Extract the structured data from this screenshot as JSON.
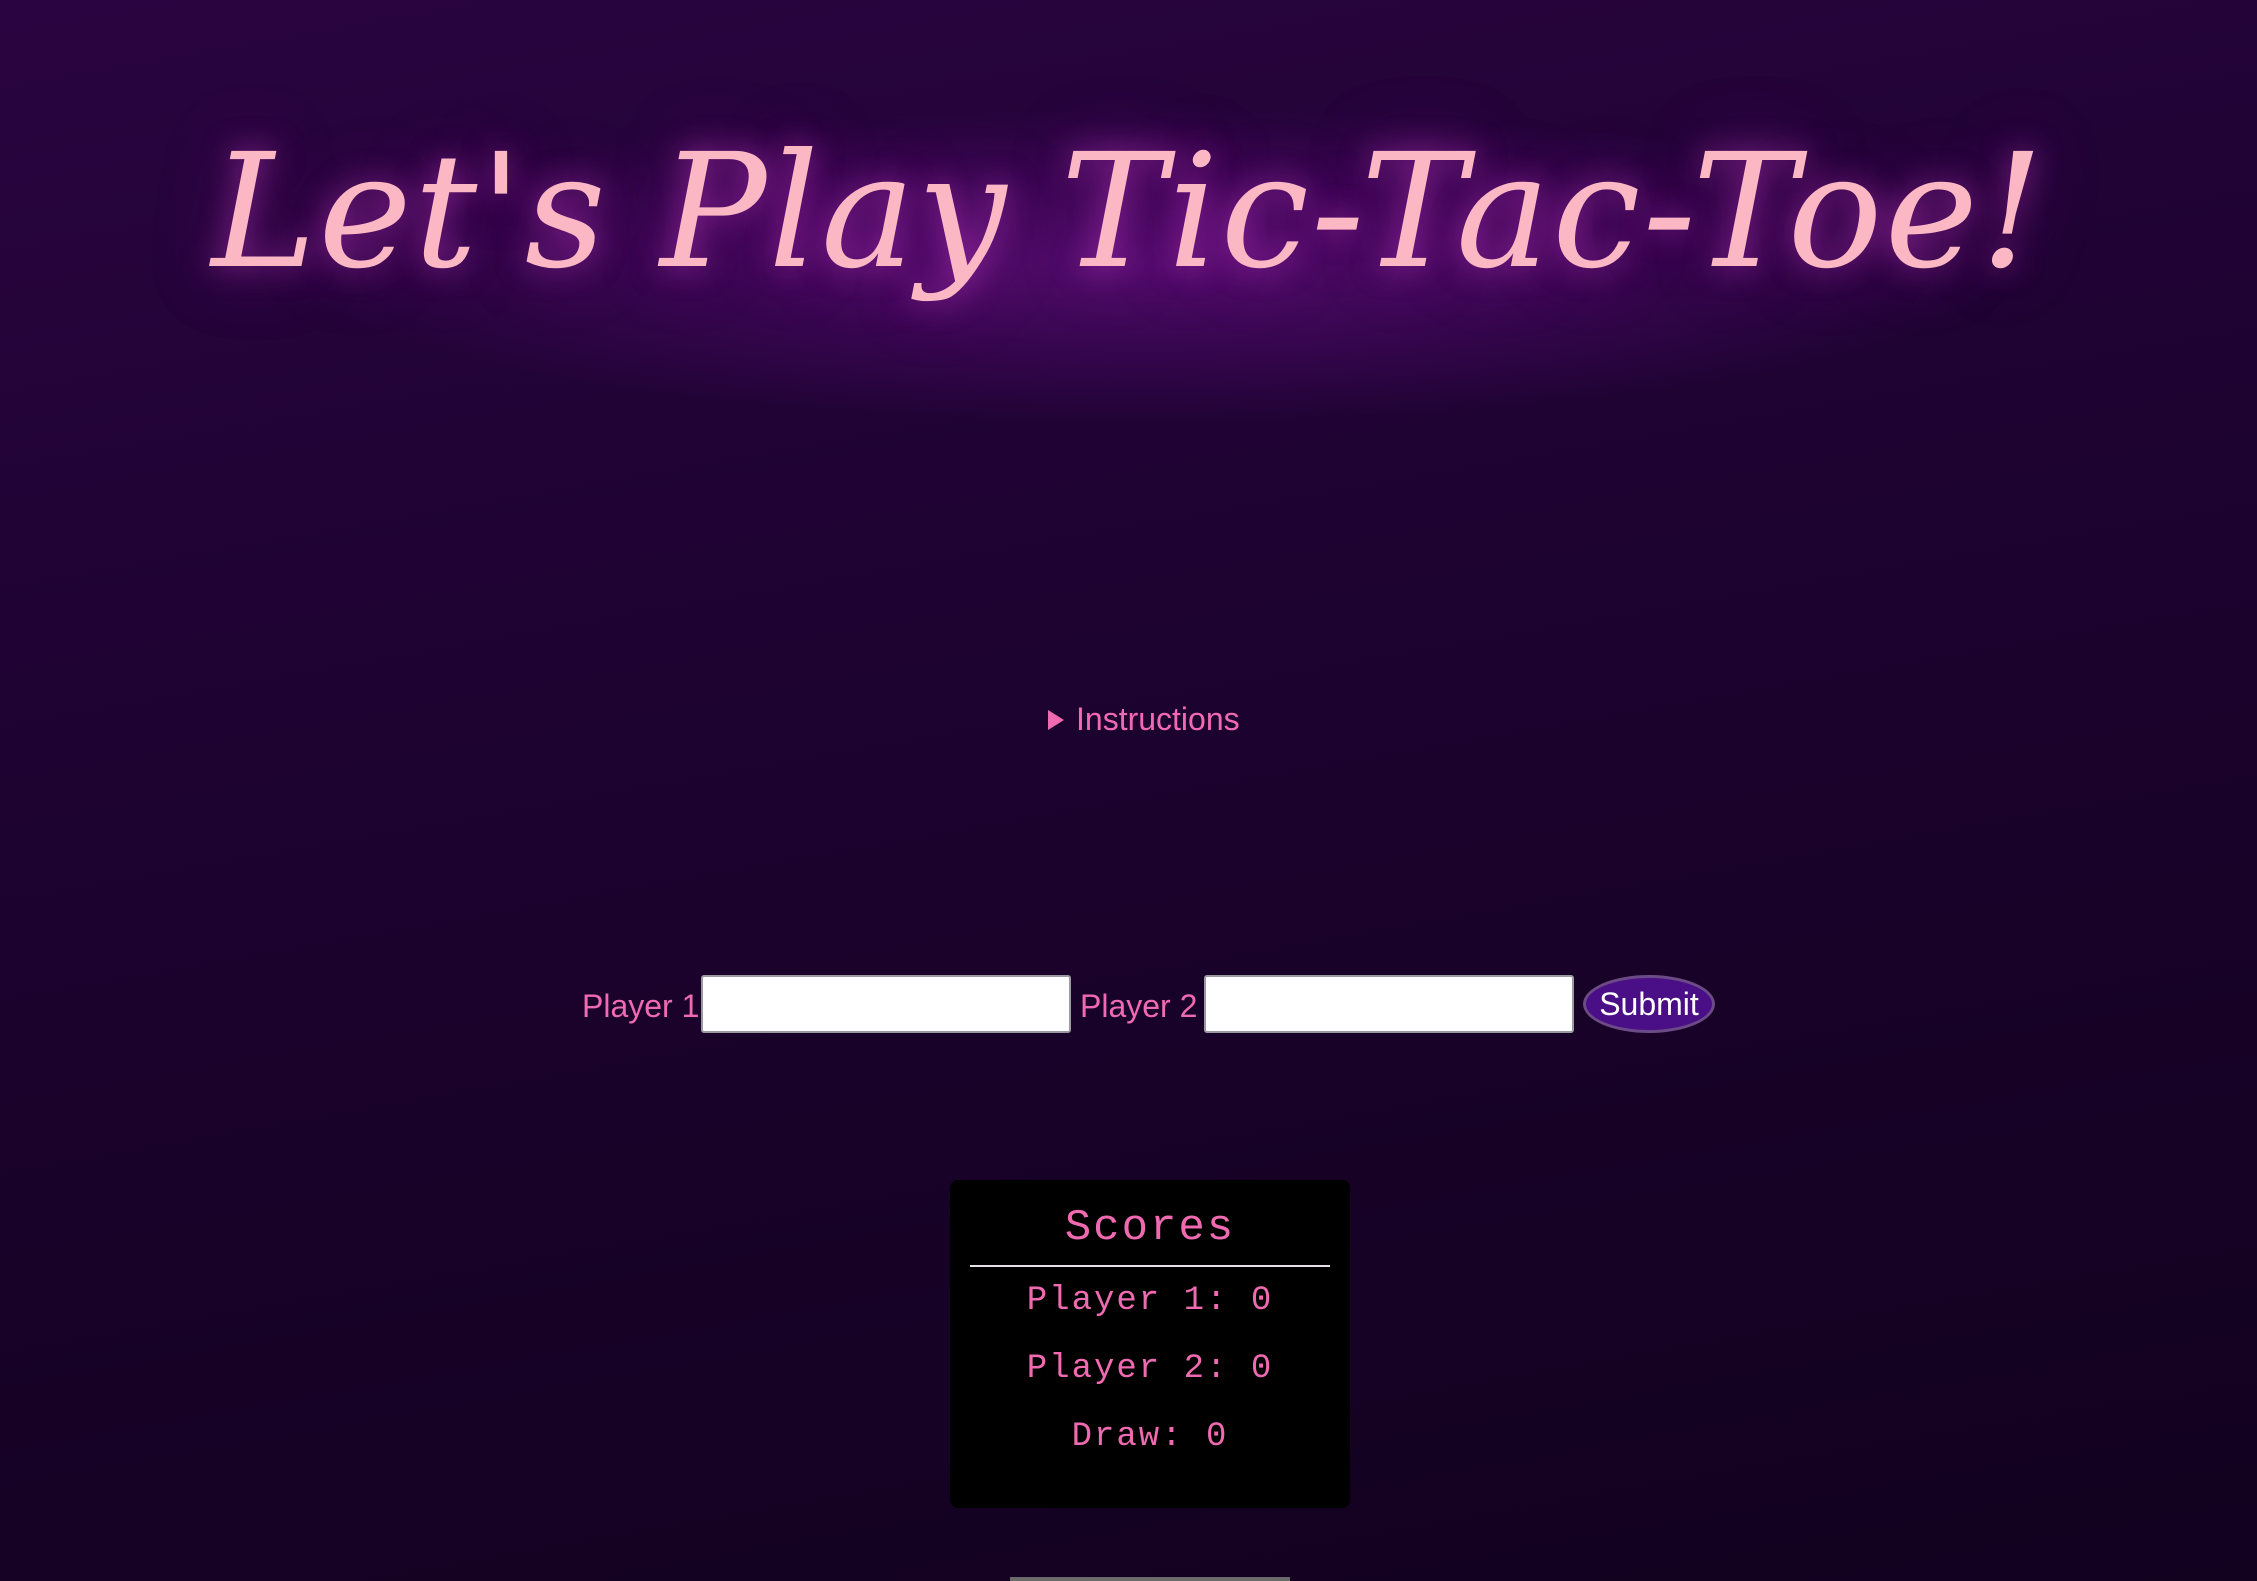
{
  "title": "Let's Play Tic-Tac-Toe!",
  "instructions": {
    "label": "Instructions",
    "expanded": false
  },
  "form": {
    "player1_label": "Player 1",
    "player1_value": "",
    "player2_label": "Player 2",
    "player2_value": "",
    "submit_label": "Submit"
  },
  "scores": {
    "title": "Scores",
    "player1": "Player 1: 0",
    "player2": "Player 2: 0",
    "draw": "Draw: 0"
  },
  "colors": {
    "background": "#1f0333",
    "title_text": "#fbb8c4",
    "accent_pink": "#f06ab2",
    "submit_button": "#4a0e86",
    "scores_panel": "#000000"
  },
  "icons": {
    "instructions_toggle": "disclosure-triangle-right-icon"
  }
}
